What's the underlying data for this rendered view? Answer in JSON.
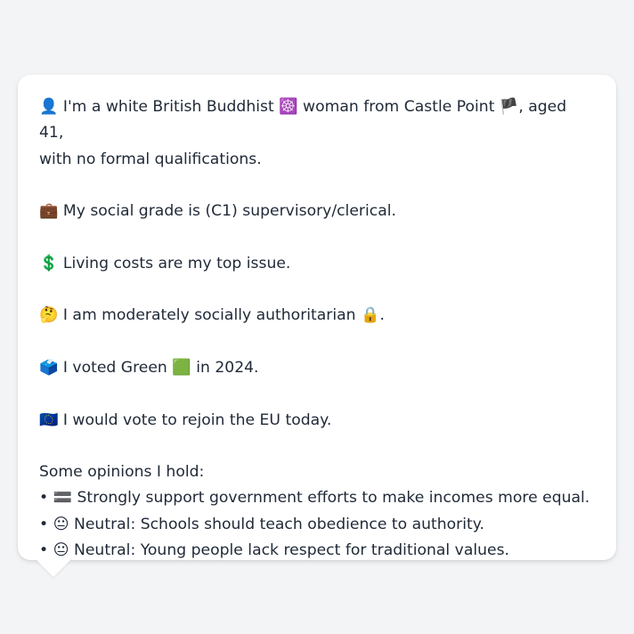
{
  "profile": {
    "intro_icon": "👤",
    "intro_text_1": "I'm a white British Buddhist",
    "buddhism_icon": "☸️",
    "intro_text_2": "woman from Castle Point",
    "england_flag_icon": "🏴",
    "intro_text_3": ", aged 41,",
    "intro_text_4": "with no formal qualifications.",
    "grade_icon": "💼",
    "grade_text": "My social grade is (C1) supervisory/clerical.",
    "issue_icon": "💲",
    "issue_text": "Living costs are my top issue.",
    "ideology_icon": "🤔",
    "ideology_text": "I am moderately socially authoritarian",
    "ideology_end_icon": "🔒",
    "ideology_end_text": ".",
    "vote_icon": "🗳️",
    "vote_text_1": "I voted Green",
    "party_icon": "🟩",
    "vote_text_2": "in 2024.",
    "eu_icon": "🇪🇺",
    "eu_text": "I would vote to rejoin the EU today."
  },
  "opinions": {
    "heading": "Some opinions I hold:",
    "items": [
      {
        "bullet": "•",
        "icon": "🟰",
        "text": "Strongly support government efforts to make incomes more equal."
      },
      {
        "bullet": "•",
        "icon": "😐",
        "text": "Neutral: Schools should teach obedience to authority."
      },
      {
        "bullet": "•",
        "icon": "😐",
        "text": "Neutral: Young people lack respect for traditional values."
      }
    ]
  }
}
